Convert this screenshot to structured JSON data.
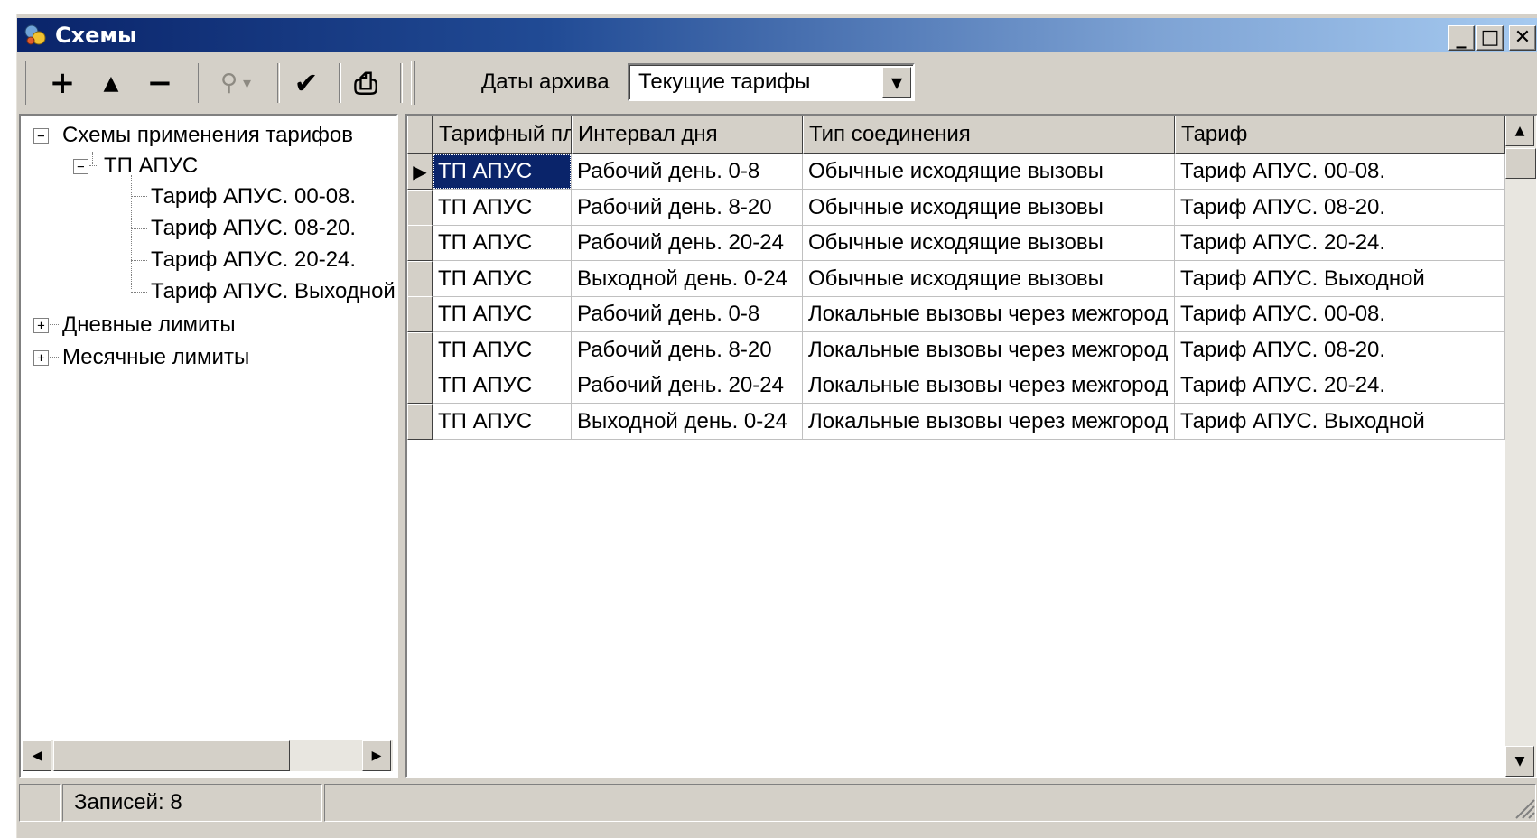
{
  "window": {
    "title": "Схемы",
    "buttons": {
      "minimize": "_",
      "maximize": "□",
      "close": "✕"
    }
  },
  "toolbar": {
    "add": "+",
    "up": "▲",
    "remove": "−",
    "find": "⚲",
    "find_dropdown": "▾",
    "apply": "✔",
    "print": "⎙",
    "archive_label": "Даты архива",
    "archive_value": "Текущие тарифы",
    "combo_arrow": "▼"
  },
  "tree": {
    "items": [
      {
        "label": "Схемы применения тарифов",
        "toggle": "−"
      },
      {
        "label": "ТП АПУС",
        "toggle": "−"
      },
      {
        "label": "Тариф АПУС. 00-08."
      },
      {
        "label": "Тариф АПУС. 08-20."
      },
      {
        "label": "Тариф АПУС. 20-24."
      },
      {
        "label": "Тариф АПУС. Выходной"
      },
      {
        "label": "Дневные лимиты",
        "toggle": "+"
      },
      {
        "label": "Месячные лимиты",
        "toggle": "+"
      }
    ],
    "scroll_left": "◀",
    "scroll_right": "▶"
  },
  "grid": {
    "columns": [
      "Тарифный план",
      "Интервал дня",
      "Тип соединения",
      "Тариф"
    ],
    "current_row_marker": "▶",
    "rows": [
      [
        "ТП АПУС",
        "Рабочий день. 0-8",
        "Обычные исходящие вызовы",
        "Тариф АПУС. 00-08."
      ],
      [
        "ТП АПУС",
        "Рабочий день. 8-20",
        "Обычные исходящие вызовы",
        "Тариф АПУС. 08-20."
      ],
      [
        "ТП АПУС",
        "Рабочий день. 20-24",
        "Обычные исходящие вызовы",
        "Тариф АПУС. 20-24."
      ],
      [
        "ТП АПУС",
        "Выходной день. 0-24",
        "Обычные исходящие вызовы",
        "Тариф АПУС. Выходной"
      ],
      [
        "ТП АПУС",
        "Рабочий день. 0-8",
        "Локальные вызовы через межгород",
        "Тариф АПУС. 00-08."
      ],
      [
        "ТП АПУС",
        "Рабочий день. 8-20",
        "Локальные вызовы через межгород",
        "Тариф АПУС. 08-20."
      ],
      [
        "ТП АПУС",
        "Рабочий день. 20-24",
        "Локальные вызовы через межгород",
        "Тариф АПУС. 20-24."
      ],
      [
        "ТП АПУС",
        "Выходной день. 0-24",
        "Локальные вызовы через межгород",
        "Тариф АПУС. Выходной"
      ]
    ],
    "scroll_up": "▲",
    "scroll_down": "▼"
  },
  "status": {
    "records": "Записей: 8"
  },
  "colors": {
    "face": "#d4d0c8",
    "title_start": "#0a246a",
    "title_end": "#a6caf0",
    "selection": "#0a246a"
  }
}
